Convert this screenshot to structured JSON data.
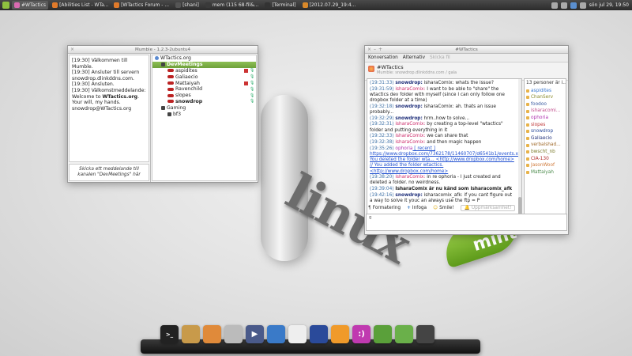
{
  "top_panel": {
    "tasks": [
      {
        "label": "#WTactics",
        "color": "#d96ab0",
        "active": true
      },
      {
        "label": "[Abilities List - WTa...",
        "color": "#e07a2a",
        "active": false
      },
      {
        "label": "[WTactics Forum - ...",
        "color": "#e07a2a",
        "active": false
      },
      {
        "label": "[shani]",
        "color": "#555555",
        "active": false
      },
      {
        "label": "mem (115 68-fil&...",
        "color": "#3a3a3a",
        "active": false
      },
      {
        "label": "[Terminal]",
        "color": "#333333",
        "active": false
      },
      {
        "label": "[2012.07.29_19:4...",
        "color": "#d9892a",
        "active": false
      }
    ],
    "clock": "sön jul 29, 19:50"
  },
  "mumble": {
    "title": "Mumble - 1.2.3-2ubuntu4",
    "log": [
      "[19:30] Välkommen till Mumble.",
      "[19:30] Ansluter till servern snowdrop.dlinkddns.com.",
      "[19:30] Ansluten.",
      "[19:30] Välkomstmeddelande: Welcome to",
      "WTactics.org",
      ". Your will, my hands. snowdrop@WTactics.org"
    ],
    "input_placeholder": "Skicka ett meddelande till kanalen \"DevMeetings\" här",
    "tree": [
      {
        "label": "WTactics.org",
        "kind": "server",
        "indent": 0
      },
      {
        "label": "DevMeetings",
        "kind": "channel-selected",
        "indent": 1
      },
      {
        "label": "aspidites",
        "kind": "user",
        "indent": 2,
        "bold": false,
        "flag": true
      },
      {
        "label": "Galiaecio",
        "kind": "user",
        "indent": 2,
        "bold": false,
        "flag": false
      },
      {
        "label": "Mattaiyah",
        "kind": "user",
        "indent": 2,
        "bold": false,
        "flag": true
      },
      {
        "label": "Ravenchild",
        "kind": "user",
        "indent": 2,
        "bold": false,
        "flag": false
      },
      {
        "label": "slopes",
        "kind": "user",
        "indent": 2,
        "bold": false,
        "flag": false
      },
      {
        "label": "snowdrop",
        "kind": "user",
        "indent": 2,
        "bold": true,
        "flag": false
      },
      {
        "label": "Gaming",
        "kind": "channel",
        "indent": 1
      },
      {
        "label": "bf3",
        "kind": "channel",
        "indent": 2
      }
    ]
  },
  "xchat": {
    "title": "#WTactics",
    "menu": [
      "Konversation",
      "Alternativ",
      "Skicka fil"
    ],
    "channel": "#WTactics",
    "topic": "Mumble: snowdrop.dlinkddns.com / gala",
    "user_count": "13 personer är i...",
    "messages": [
      {
        "time": "(19:31:33)",
        "nick": "snowdrop:",
        "nick_class": "nk-s",
        "text": " isharaComix: whats the issue?"
      },
      {
        "time": "(19:31:59)",
        "nick": "isharaComix:",
        "nick_class": "nk-i",
        "text": " I want to be able to \"share\" the wtactics dev folder with myself (since I can only follow one dropbox folder at a time)"
      },
      {
        "time": "(19:32:18)",
        "nick": "snowdrop:",
        "nick_class": "nk-s",
        "text": " isharaComix: ah. thats an issue probably..."
      },
      {
        "time": "(19:32:29)",
        "nick": "snowdrop:",
        "nick_class": "nk-s",
        "text": " hrm..how to solve..."
      },
      {
        "time": "(19:32:31)",
        "nick": "isharaComix:",
        "nick_class": "nk-i",
        "text": " by creating a top-level \"wtactics\" folder and putting everything in it"
      },
      {
        "time": "(19:32:33)",
        "nick": "isharaComix:",
        "nick_class": "nk-i",
        "text": " we can share that"
      },
      {
        "time": "(19:32:38)",
        "nick": "isharaComix:",
        "nick_class": "nk-i",
        "text": " and then magic happen"
      },
      {
        "time": "(19:35:26)",
        "nick": "ophoria",
        "nick_class": "nk-o",
        "text": " [ recent ] https://www.dropbox.com/7362178/11460707/d6541b1/events.xml: You deleted the folder wta... <http://www.dropbox.com/home> // You added the folder wtactics. <http://www.dropbox.com/home>"
      },
      {
        "time": "(19:38:20)",
        "nick": "isharaComix:",
        "nick_class": "nk-i",
        "text": " in re ophoria - I just created and deleted a folder. no weirdness."
      },
      {
        "time": "(19:39:04)",
        "nick": "IsharaComix är nu känd som isharacomix_afk",
        "nick_class": "bold-line",
        "text": ""
      },
      {
        "time": "(19:42:16)",
        "nick": "snowdrop:",
        "nick_class": "nk-s",
        "text": " isharacomix_afk: if you cant figure out a way to solve it youc an always use the ftp = P"
      }
    ],
    "users": [
      {
        "name": "aspidites",
        "color": "#3a78d0"
      },
      {
        "name": "ChanServ",
        "color": "#8a8a2a"
      },
      {
        "name": "foodoo",
        "color": "#3a5aa0"
      },
      {
        "name": "isharacomi...",
        "color": "#c04a8a"
      },
      {
        "name": "ophoria",
        "color": "#b034b0"
      },
      {
        "name": "slopes",
        "color": "#c03a3a"
      },
      {
        "name": "snowdrop",
        "color": "#2a4a9a"
      },
      {
        "name": "Galiaecio",
        "color": "#1f2f7a"
      },
      {
        "name": "verbalshad...",
        "color": "#a06a2a"
      },
      {
        "name": "bwscht_nb",
        "color": "#7a7a2a"
      },
      {
        "name": "CIA-130",
        "color": "#b02a2a"
      },
      {
        "name": "JasonWoof",
        "color": "#d07a3a"
      },
      {
        "name": "Mattaiyah",
        "color": "#4a8a4a"
      }
    ],
    "nick": "g",
    "toolbar": {
      "formatting": "Formatering",
      "insert": "Infoga",
      "smile": "Smile!",
      "attention": "Uppmärksamhet!"
    }
  },
  "desktop_logo": {
    "text": "linux",
    "badge": "mint"
  },
  "dock_apps": [
    {
      "name": "terminal-icon",
      "color": "#222222",
      "glyph": ">_"
    },
    {
      "name": "package-icon",
      "color": "#c89a4a",
      "glyph": ""
    },
    {
      "name": "paint-icon",
      "color": "#e08a3a",
      "glyph": ""
    },
    {
      "name": "calculator-icon",
      "color": "#bbbbbb",
      "glyph": ""
    },
    {
      "name": "media-player-icon",
      "color": "#4a5a8a",
      "glyph": "▶"
    },
    {
      "name": "document-icon",
      "color": "#3a7ac8",
      "glyph": ""
    },
    {
      "name": "image-viewer-icon",
      "color": "#eeeeee",
      "glyph": ""
    },
    {
      "name": "browser-icon",
      "color": "#2a4a9a",
      "glyph": ""
    },
    {
      "name": "camera-icon",
      "color": "#f09a2a",
      "glyph": ""
    },
    {
      "name": "chat-icon",
      "color": "#c03ab0",
      "glyph": ":)"
    },
    {
      "name": "home-folder-icon",
      "color": "#5aa03a",
      "glyph": ""
    },
    {
      "name": "folder-icon",
      "color": "#6ab04a",
      "glyph": ""
    },
    {
      "name": "trash-icon",
      "color": "#444444",
      "glyph": ""
    }
  ]
}
